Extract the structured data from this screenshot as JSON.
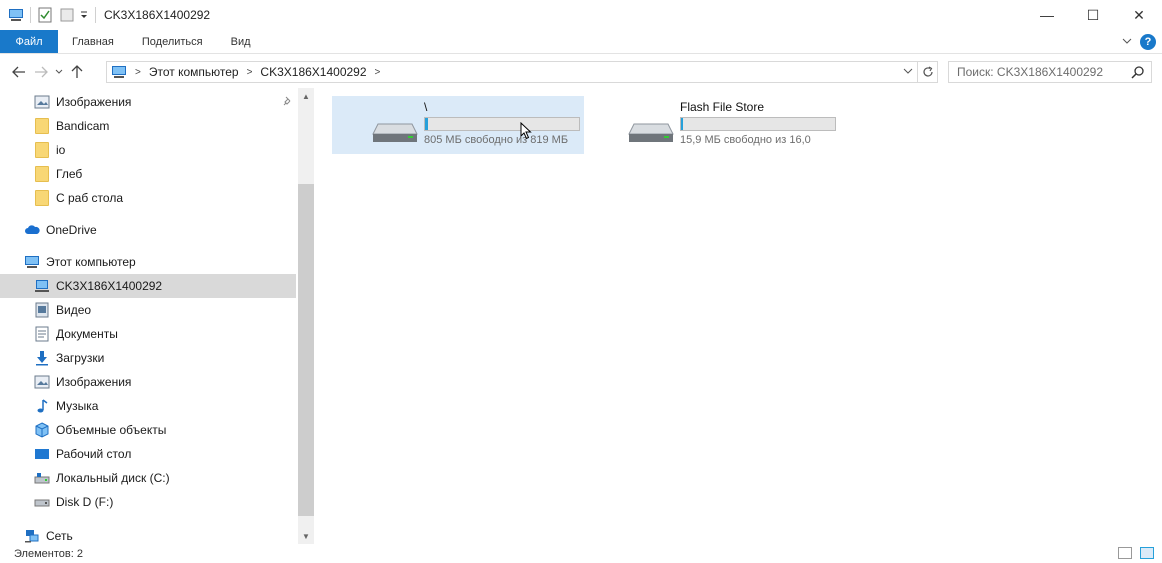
{
  "window": {
    "title": "CK3X186X1400292",
    "controls": {
      "minimize": "—",
      "maximize": "☐",
      "close": "✕"
    }
  },
  "ribbon": {
    "tabs": [
      "Файл",
      "Главная",
      "Поделиться",
      "Вид"
    ],
    "expand_icon": "chevron-down-icon",
    "help_label": "?"
  },
  "address": {
    "breadcrumbs": [
      "Этот компьютер",
      "CK3X186X1400292"
    ],
    "search_placeholder": "Поиск: CK3X186X1400292"
  },
  "nav": {
    "quick_access": [
      {
        "label": "Изображения",
        "icon": "pictures-icon",
        "pinned": true
      },
      {
        "label": "Bandicam",
        "icon": "folder-icon"
      },
      {
        "label": "io",
        "icon": "folder-icon"
      },
      {
        "label": "Глеб",
        "icon": "folder-icon"
      },
      {
        "label": "С раб стола",
        "icon": "folder-icon"
      }
    ],
    "onedrive": "OneDrive",
    "this_pc": "Этот компьютер",
    "this_pc_items": [
      {
        "label": "CK3X186X1400292",
        "icon": "device-icon",
        "selected": true
      },
      {
        "label": "Видео",
        "icon": "video-icon"
      },
      {
        "label": "Документы",
        "icon": "documents-icon"
      },
      {
        "label": "Загрузки",
        "icon": "downloads-icon"
      },
      {
        "label": "Изображения",
        "icon": "pictures-icon"
      },
      {
        "label": "Музыка",
        "icon": "music-icon"
      },
      {
        "label": "Объемные объекты",
        "icon": "3d-objects-icon"
      },
      {
        "label": "Рабочий стол",
        "icon": "desktop-icon"
      },
      {
        "label": "Локальный диск (C:)",
        "icon": "local-disk-icon"
      },
      {
        "label": "Disk D (F:)",
        "icon": "disk-icon"
      }
    ],
    "network": "Сеть"
  },
  "drives": [
    {
      "name": "\\",
      "info": "805 МБ свободно из 819 МБ",
      "used_fraction": 0.02,
      "selected": true
    },
    {
      "name": "Flash File Store",
      "info": "15,9 МБ свободно из 16,0",
      "used_fraction": 0.01,
      "selected": false
    }
  ],
  "status": {
    "items_text": "Элементов: 2"
  },
  "colors": {
    "accent": "#1979ca",
    "selection": "#dbeaf8",
    "progress": "#26a0da",
    "nav_selected": "#d9d9d9"
  }
}
